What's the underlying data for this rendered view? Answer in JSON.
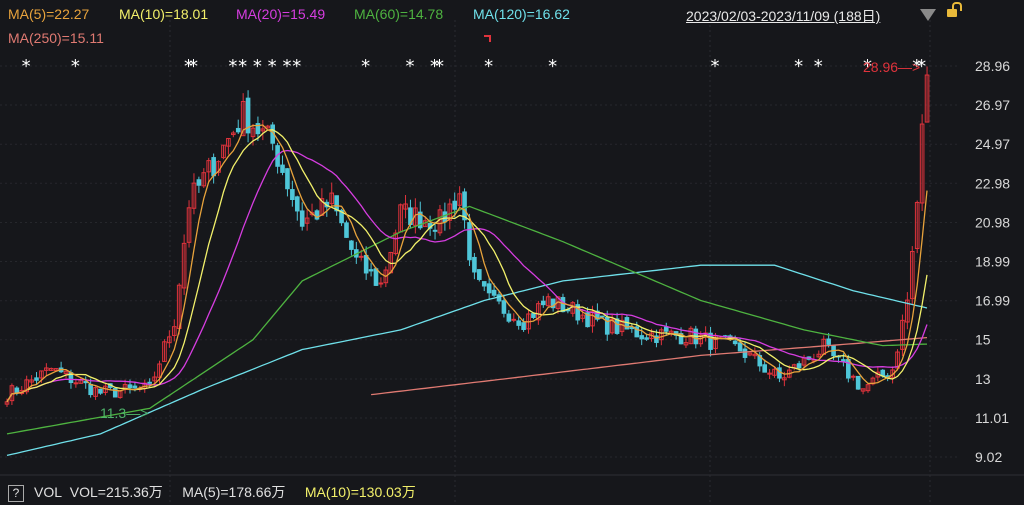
{
  "legend": {
    "ma5": "MA(5)=22.27",
    "ma10": "MA(10)=18.01",
    "ma20": "MA(20)=15.49",
    "ma60": "MA(60)=14.78",
    "ma120": "MA(120)=16.62",
    "ma250": "MA(250)=15.11"
  },
  "range_label": "2023/02/03-2023/11/09 (188日)",
  "colors": {
    "ma5": "#e8a33c",
    "ma10": "#f2f06a",
    "ma20": "#d63de0",
    "ma60": "#4eb340",
    "ma120": "#6fe0ea",
    "ma250": "#e07a72",
    "up": "#e0333c",
    "down": "#4fc6d8"
  },
  "volume_bar": {
    "help": "?",
    "vol": "VOL",
    "vol_value": "VOL=215.36万",
    "ma5": "MA(5)=178.66万",
    "ma10": "MA(10)=130.03万"
  },
  "chart_data": {
    "type": "candlestick",
    "days": 188,
    "ylim": [
      9.02,
      28.96
    ],
    "yticks": [
      "28.96",
      "26.97",
      "24.97",
      "22.98",
      "20.98",
      "18.99",
      "16.99",
      "15",
      "13",
      "11.01",
      "9.02"
    ],
    "close_keypoints": [
      [
        0,
        12.2
      ],
      [
        9,
        13.5
      ],
      [
        19,
        12.3
      ],
      [
        29,
        12.5
      ],
      [
        34,
        16
      ],
      [
        37,
        22
      ],
      [
        42,
        24
      ],
      [
        48,
        26.5
      ],
      [
        54,
        25
      ],
      [
        60,
        21
      ],
      [
        66,
        22
      ],
      [
        71,
        19
      ],
      [
        76,
        17.8
      ],
      [
        80,
        21.5
      ],
      [
        88,
        21
      ],
      [
        92,
        22.5
      ],
      [
        95,
        18
      ],
      [
        98,
        17
      ],
      [
        105,
        16
      ],
      [
        110,
        17
      ],
      [
        115,
        16.5
      ],
      [
        121,
        15.8
      ],
      [
        129,
        15.3
      ],
      [
        139,
        15.2
      ],
      [
        149,
        14.5
      ],
      [
        157,
        13
      ],
      [
        166,
        14.6
      ],
      [
        174,
        12.5
      ],
      [
        180,
        13.5
      ],
      [
        183,
        17
      ],
      [
        185,
        22
      ],
      [
        186,
        26
      ],
      [
        187,
        28.5
      ]
    ],
    "ma60_keypoints": [
      [
        0,
        10.2
      ],
      [
        29,
        11.5
      ],
      [
        50,
        15
      ],
      [
        60,
        18
      ],
      [
        80,
        20.5
      ],
      [
        94,
        21.8
      ],
      [
        113,
        20
      ],
      [
        141,
        17
      ],
      [
        162,
        15.5
      ],
      [
        178,
        14.7
      ],
      [
        187,
        14.78
      ]
    ],
    "ma120_keypoints": [
      [
        0,
        9.1
      ],
      [
        19,
        10.2
      ],
      [
        40,
        12.5
      ],
      [
        60,
        14.5
      ],
      [
        80,
        15.5
      ],
      [
        97,
        17
      ],
      [
        113,
        18
      ],
      [
        141,
        18.8
      ],
      [
        156,
        18.8
      ],
      [
        172,
        17.5
      ],
      [
        187,
        16.62
      ]
    ],
    "ma250_keypoints": [
      [
        74,
        12.2
      ],
      [
        101,
        13
      ],
      [
        141,
        14.2
      ],
      [
        172,
        14.8
      ],
      [
        187,
        15.11
      ]
    ],
    "annotations": {
      "low": "11.3",
      "high": "28.96"
    },
    "star_days": [
      4,
      14,
      37,
      38,
      46,
      48,
      51,
      54,
      57,
      59,
      73,
      82,
      87,
      88,
      98,
      111,
      144,
      161,
      165,
      175,
      185,
      186
    ]
  }
}
